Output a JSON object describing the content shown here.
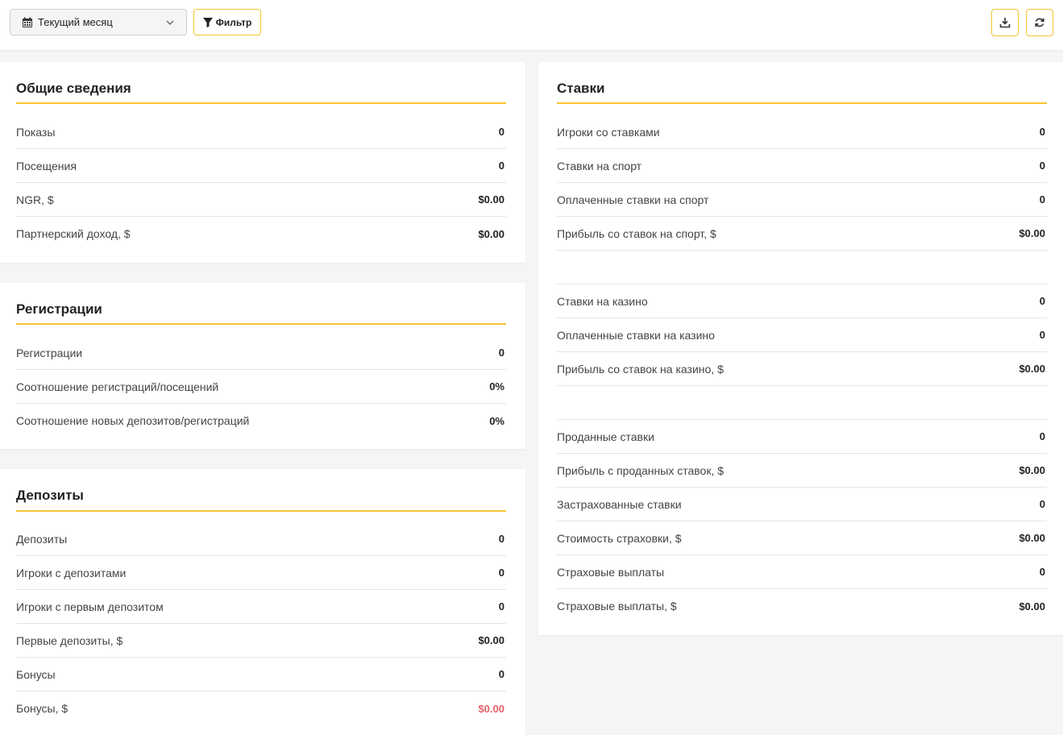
{
  "toolbar": {
    "period_value": "Текущий месяц",
    "filter_label": "Фильтр",
    "icons": {
      "calendar": "calendar-icon",
      "chevron": "chevron-down-icon",
      "filter": "filter-icon",
      "download": "download-icon",
      "refresh": "refresh-icon"
    }
  },
  "colors": {
    "accent": "#f4c430",
    "negative": "#e5616c"
  },
  "general": {
    "title": "Общие сведения",
    "rows": [
      {
        "label": "Показы",
        "value": "0"
      },
      {
        "label": "Посещения",
        "value": "0"
      },
      {
        "label": "NGR, $",
        "value": "$0.00"
      },
      {
        "label": "Партнерский доход, $",
        "value": "$0.00"
      }
    ]
  },
  "registrations": {
    "title": "Регистрации",
    "rows": [
      {
        "label": "Регистрации",
        "value": "0"
      },
      {
        "label": "Соотношение регистраций/посещений",
        "value": "0%"
      },
      {
        "label": "Соотношение новых депозитов/регистраций",
        "value": "0%"
      }
    ]
  },
  "deposits": {
    "title": "Депозиты",
    "rows": [
      {
        "label": "Депозиты",
        "value": "0"
      },
      {
        "label": "Игроки с депозитами",
        "value": "0"
      },
      {
        "label": "Игроки с первым депозитом",
        "value": "0"
      },
      {
        "label": "Первые депозиты, $",
        "value": "$0.00"
      },
      {
        "label": "Бонусы",
        "value": "0"
      },
      {
        "label": "Бонусы, $",
        "value": "$0.00"
      }
    ]
  },
  "bets": {
    "title": "Ставки",
    "rows": [
      {
        "label": "Игроки со ставками",
        "value": "0"
      },
      {
        "label": "Ставки на спорт",
        "value": "0"
      },
      {
        "label": "Оплаченные ставки на спорт",
        "value": "0"
      },
      {
        "label": "Прибыль со ставок на спорт, $",
        "value": "$0.00"
      },
      {
        "label": "Ставки на казино",
        "value": "0"
      },
      {
        "label": "Оплаченные ставки на казино",
        "value": "0"
      },
      {
        "label": "Прибыль со ставок на казино, $",
        "value": "$0.00"
      },
      {
        "label": "Проданные ставки",
        "value": "0"
      },
      {
        "label": "Прибыль с проданных ставок, $",
        "value": "$0.00"
      },
      {
        "label": "Застрахованные ставки",
        "value": "0"
      },
      {
        "label": "Стоимость страховки, $",
        "value": "$0.00"
      },
      {
        "label": "Страховые выплаты",
        "value": "0"
      },
      {
        "label": "Страховые выплаты, $",
        "value": "$0.00"
      }
    ]
  }
}
